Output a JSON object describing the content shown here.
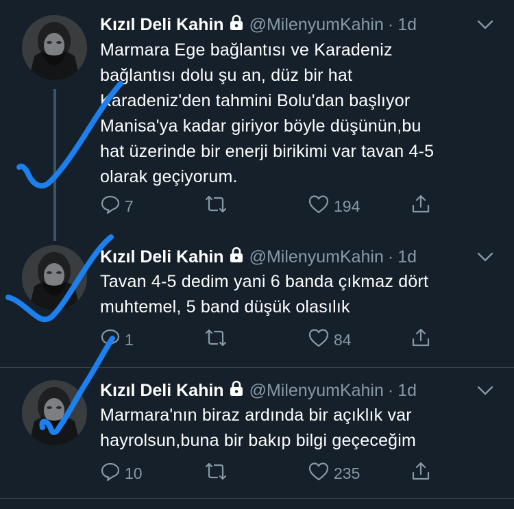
{
  "icons": {
    "lock": "lock-icon",
    "chevron": "chevron-down-icon",
    "reply": "reply-icon",
    "retweet": "retweet-icon",
    "like": "heart-icon",
    "share": "share-icon"
  },
  "colors": {
    "background": "#15202b",
    "secondary_text": "#8899a6",
    "annotation": "#1d80ef"
  },
  "tweets": [
    {
      "name": "Kızıl Deli Kahin",
      "handle": "@MilenyumKahin",
      "dot": "·",
      "time": "1d",
      "lines": [
        "Marmara Ege bağlantısı ve Karadeniz",
        "bağlantısı dolu şu an, düz bir hat",
        "Karadeniz'den tahmini Bolu'dan başlıyor",
        "Manisa'ya kadar giriyor böyle düşünün,bu",
        "hat üzerinde bir enerji birikimi var tavan 4-5",
        "olarak geçiyorum."
      ],
      "replies": "7",
      "retweets": "",
      "likes": "194"
    },
    {
      "name": "Kızıl Deli Kahin",
      "handle": "@MilenyumKahin",
      "dot": "·",
      "time": "1d",
      "lines": [
        "Tavan 4-5 dedim yani 6 banda çıkmaz dört",
        "muhtemel, 5 band düşük olasılık"
      ],
      "replies": "1",
      "retweets": "",
      "likes": "84"
    },
    {
      "name": "Kızıl Deli Kahin",
      "handle": "@MilenyumKahin",
      "dot": "·",
      "time": "1d",
      "lines": [
        "Marmara'nın biraz ardında bir açıklık var",
        "hayrolsun,buna bir bakıp bilgi geçeceğim"
      ],
      "replies": "10",
      "retweets": "",
      "likes": "235"
    }
  ]
}
